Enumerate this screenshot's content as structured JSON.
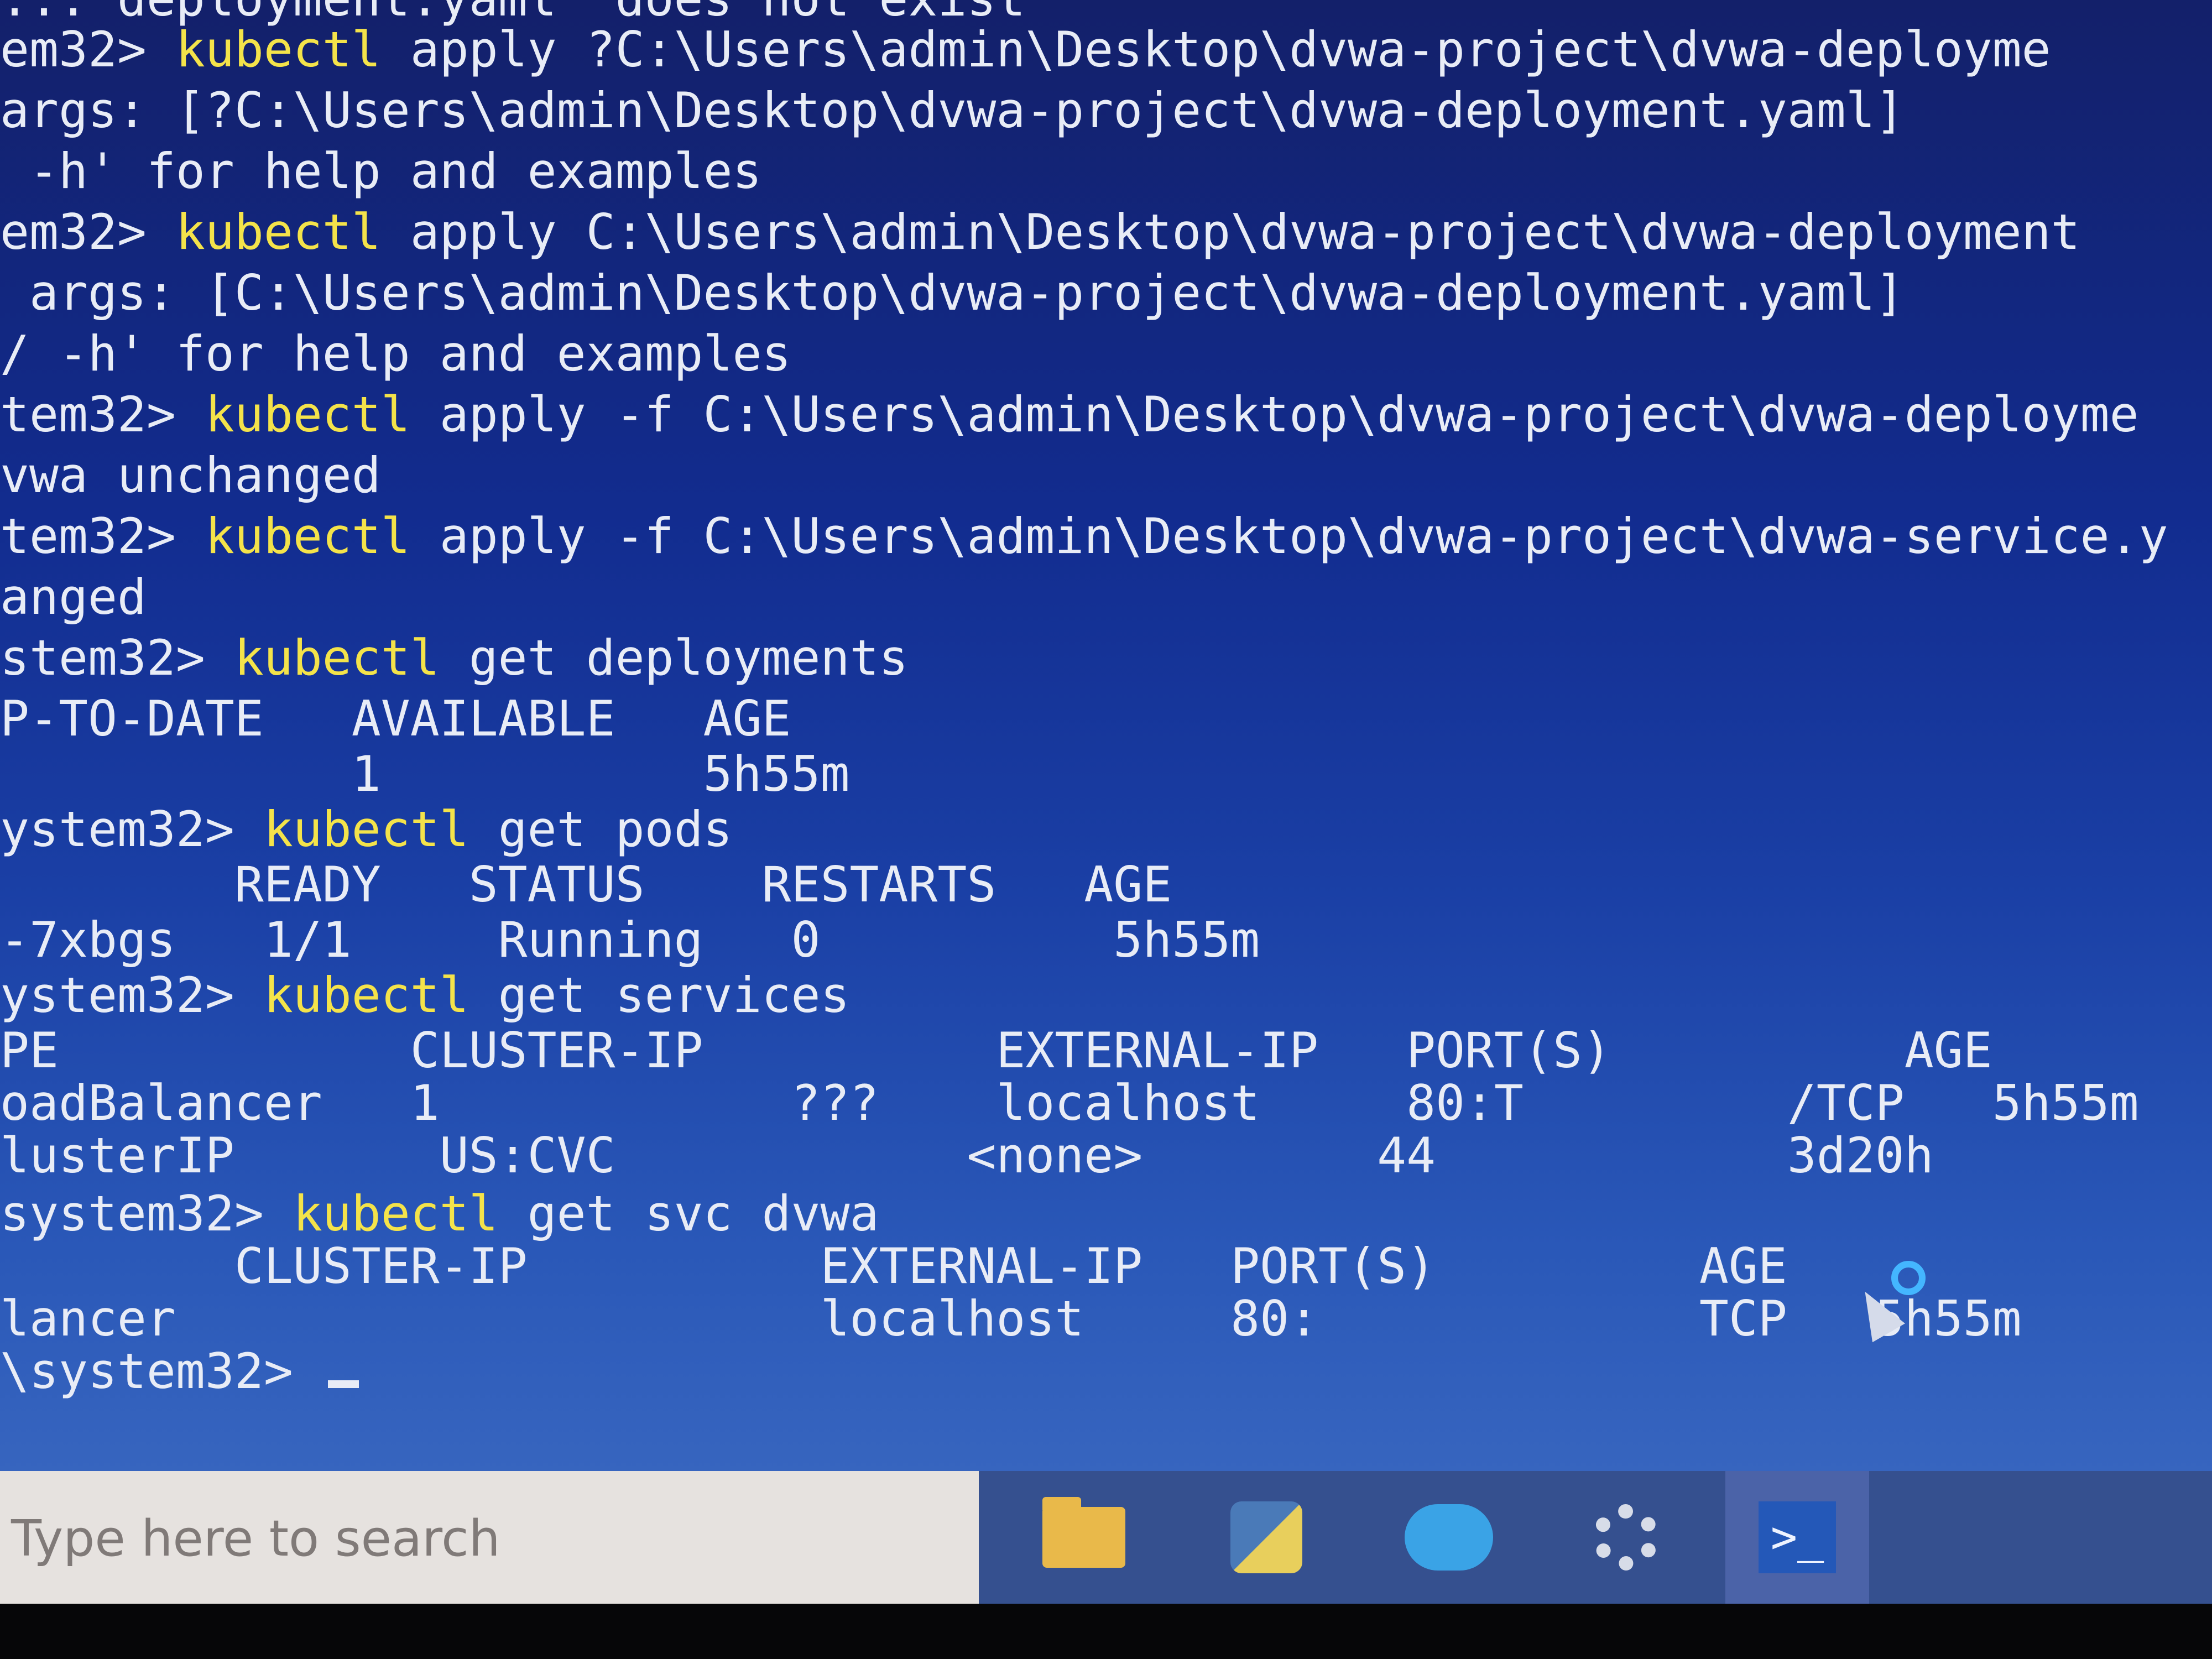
{
  "terminal": {
    "lines": [
      {
        "prompt": "",
        "cmd": "",
        "rest": "... deployment.yaml\" does not exist"
      },
      {
        "prompt": "em32> ",
        "cmd": "kubectl",
        "rest": " apply ?C:\\Users\\admin\\Desktop\\dvwa-project\\dvwa-deployme"
      },
      {
        "prompt": "",
        "cmd": "",
        "rest": "args: [?C:\\Users\\admin\\Desktop\\dvwa-project\\dvwa-deployment.yaml]"
      },
      {
        "prompt": "",
        "cmd": "",
        "rest": " -h' for help and examples"
      },
      {
        "prompt": "em32> ",
        "cmd": "kubectl",
        "rest": " apply C:\\Users\\admin\\Desktop\\dvwa-project\\dvwa-deployment"
      },
      {
        "prompt": "",
        "cmd": "",
        "rest": " args: [C:\\Users\\admin\\Desktop\\dvwa-project\\dvwa-deployment.yaml]"
      },
      {
        "prompt": "",
        "cmd": "",
        "rest": "/ -h' for help and examples"
      },
      {
        "prompt": "tem32> ",
        "cmd": "kubectl",
        "rest": " apply -f C:\\Users\\admin\\Desktop\\dvwa-project\\dvwa-deployme"
      },
      {
        "prompt": "",
        "cmd": "",
        "rest": "vwa unchanged"
      },
      {
        "prompt": "tem32> ",
        "cmd": "kubectl",
        "rest": " apply -f C:\\Users\\admin\\Desktop\\dvwa-project\\dvwa-service.y"
      },
      {
        "prompt": "",
        "cmd": "",
        "rest": "anged"
      },
      {
        "prompt": "stem32> ",
        "cmd": "kubectl",
        "rest": " get deployments"
      },
      {
        "prompt": "",
        "cmd": "",
        "rest": "P-TO-DATE   AVAILABLE   AGE"
      },
      {
        "prompt": "",
        "cmd": "",
        "rest": "            1           5h55m"
      },
      {
        "prompt": "ystem32> ",
        "cmd": "kubectl",
        "rest": " get pods"
      },
      {
        "prompt": "",
        "cmd": "",
        "rest": "        READY   STATUS    RESTARTS   AGE"
      },
      {
        "prompt": "",
        "cmd": "",
        "rest": "-7xbgs   1/1     Running   0          5h55m"
      },
      {
        "prompt": "ystem32> ",
        "cmd": "kubectl",
        "rest": " get services"
      },
      {
        "prompt": "",
        "cmd": "",
        "rest": "PE            CLUSTER-IP          EXTERNAL-IP   PORT(S)          AGE"
      },
      {
        "prompt": "",
        "cmd": "",
        "rest": "oadBalancer   1            ???    localhost     80:T         /TCP   5h55m"
      },
      {
        "prompt": "",
        "cmd": "",
        "rest": "lusterIP       US:CVC            <none>        44            3d20h"
      },
      {
        "prompt": "system32> ",
        "cmd": "kubectl",
        "rest": " get svc dvwa"
      },
      {
        "prompt": "",
        "cmd": "",
        "rest": "        CLUSTER-IP          EXTERNAL-IP   PORT(S)         AGE"
      },
      {
        "prompt": "",
        "cmd": "",
        "rest": "lancer                      localhost     80:             TCP   5h55m"
      },
      {
        "prompt": "\\system32> ",
        "cmd": "",
        "rest": ""
      }
    ]
  },
  "taskbar": {
    "search_placeholder": "Type here to search",
    "icons": [
      "file-explorer-icon",
      "python-icon",
      "docker-icon",
      "settings-gear-icon",
      "powershell-icon"
    ],
    "powershell_glyph": ">_"
  },
  "colors": {
    "terminal_bg": "#1a3fa5",
    "command": "#f4e34a",
    "text": "#e8ecf6",
    "taskbar": "#35508f"
  }
}
